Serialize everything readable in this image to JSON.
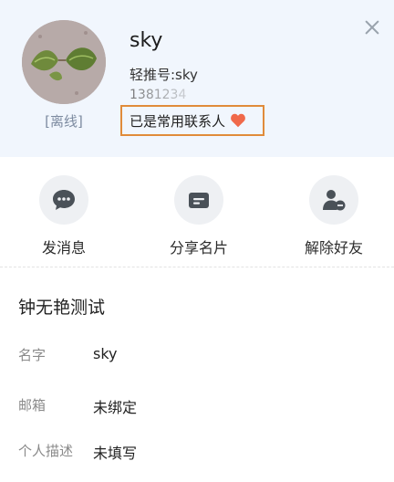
{
  "header": {
    "username": "sky",
    "qing_id": "轻推号:sky",
    "phone": "1381234",
    "status": "[离线]",
    "contact_status": "已是常用联系人",
    "heart_color": "#f0694a"
  },
  "actions": [
    {
      "label": "发消息",
      "icon": "chat-icon"
    },
    {
      "label": "分享名片",
      "icon": "card-icon"
    },
    {
      "label": "解除好友",
      "icon": "remove-friend-icon"
    }
  ],
  "profile": {
    "title": "钟无艳测试",
    "fields": [
      {
        "key": "名字",
        "value": "sky"
      },
      {
        "key": "邮箱",
        "value": "未绑定"
      },
      {
        "key": "个人描述",
        "value": "未填写"
      }
    ]
  }
}
